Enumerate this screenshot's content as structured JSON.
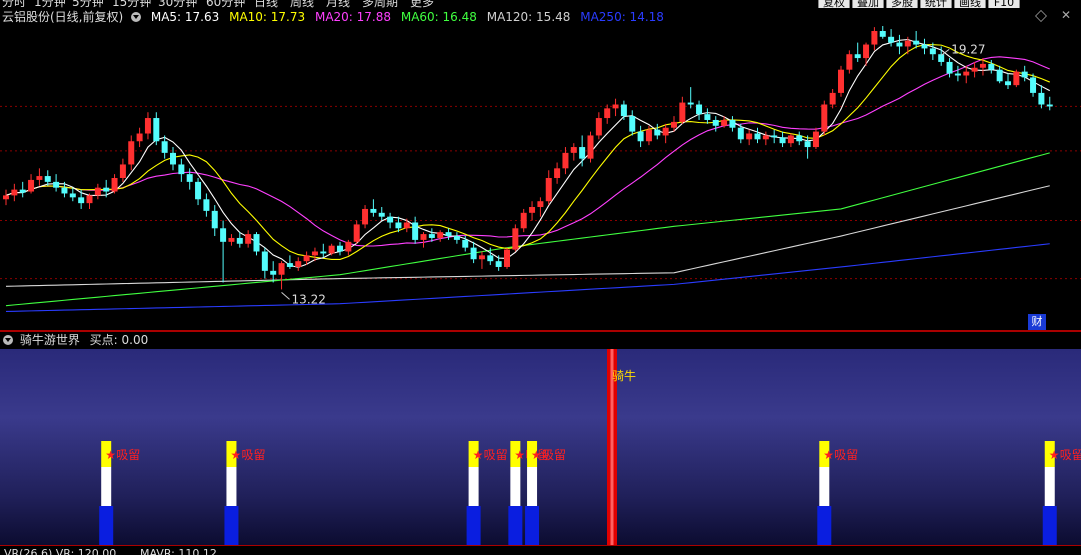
{
  "header": {
    "stock_name": "云铝股份(日线,前复权)",
    "ma_items": [
      {
        "label": "MA5: 17.63",
        "color": "#ffffff"
      },
      {
        "label": "MA10: 17.73",
        "color": "#ffff00"
      },
      {
        "label": "MA20: 17.88",
        "color": "#ff40ff"
      },
      {
        "label": "MA60: 16.48",
        "color": "#40ff40"
      },
      {
        "label": "MA120: 15.48",
        "color": "#d0d0d0"
      },
      {
        "label": "MA250: 14.18",
        "color": "#2a3cff"
      }
    ]
  },
  "top_tabs": [
    "分时",
    "1分钟",
    "5分钟",
    "15分钟",
    "30分钟",
    "60分钟",
    "日线",
    "周线",
    "月线",
    "多周期",
    "更多"
  ],
  "top_buttons": [
    "复权",
    "叠加",
    "多股",
    "统计",
    "画线",
    "F10"
  ],
  "indicator": {
    "name": "骑牛游世界",
    "value_label": "买点: 0.00"
  },
  "bottom_text": [
    "VR(26,6) VR: 120.00",
    "MAVR: 110.12"
  ],
  "badge": "财",
  "colors": {
    "up": "#ff3030",
    "down": "#54fcfc",
    "grid": "#8b0000"
  },
  "chart_data": [
    {
      "type": "candlestick",
      "ylim": [
        12.3,
        19.9
      ],
      "annotations": [
        {
          "label": "19.27",
          "index": 112,
          "value": 19.27
        },
        {
          "label": "13.22",
          "index": 33,
          "value": 13.22
        }
      ],
      "candles": [
        [
          15.55,
          15.8,
          15.4,
          15.65
        ],
        [
          15.65,
          15.95,
          15.5,
          15.8
        ],
        [
          15.8,
          16.0,
          15.6,
          15.72
        ],
        [
          15.75,
          16.2,
          15.7,
          16.05
        ],
        [
          16.05,
          16.35,
          15.9,
          16.15
        ],
        [
          16.15,
          16.3,
          15.9,
          16.0
        ],
        [
          16.0,
          16.2,
          15.75,
          15.85
        ],
        [
          15.85,
          16.0,
          15.6,
          15.7
        ],
        [
          15.7,
          15.85,
          15.5,
          15.6
        ],
        [
          15.6,
          15.8,
          15.3,
          15.45
        ],
        [
          15.45,
          15.7,
          15.3,
          15.65
        ],
        [
          15.65,
          15.95,
          15.55,
          15.85
        ],
        [
          15.85,
          16.05,
          15.6,
          15.75
        ],
        [
          15.75,
          16.2,
          15.7,
          16.1
        ],
        [
          16.1,
          16.6,
          16.0,
          16.45
        ],
        [
          16.45,
          17.2,
          16.3,
          17.05
        ],
        [
          17.05,
          17.4,
          16.9,
          17.25
        ],
        [
          17.25,
          17.8,
          17.1,
          17.65
        ],
        [
          17.65,
          17.8,
          16.95,
          17.05
        ],
        [
          17.05,
          17.2,
          16.6,
          16.75
        ],
        [
          16.75,
          16.9,
          16.3,
          16.45
        ],
        [
          16.45,
          16.6,
          16.0,
          16.2
        ],
        [
          16.2,
          16.35,
          15.8,
          16.0
        ],
        [
          16.0,
          16.1,
          15.4,
          15.55
        ],
        [
          15.55,
          15.7,
          15.1,
          15.25
        ],
        [
          15.25,
          15.4,
          14.6,
          14.8
        ],
        [
          14.8,
          15.0,
          13.4,
          14.45
        ],
        [
          14.45,
          14.65,
          14.35,
          14.55
        ],
        [
          14.55,
          14.7,
          14.3,
          14.4
        ],
        [
          14.4,
          14.75,
          14.3,
          14.65
        ],
        [
          14.65,
          14.7,
          14.1,
          14.2
        ],
        [
          14.2,
          14.3,
          13.5,
          13.7
        ],
        [
          13.7,
          13.95,
          13.4,
          13.6
        ],
        [
          13.6,
          13.95,
          13.22,
          13.9
        ],
        [
          13.9,
          14.1,
          13.75,
          13.8
        ],
        [
          13.8,
          14.05,
          13.7,
          13.95
        ],
        [
          13.95,
          14.2,
          13.85,
          14.1
        ],
        [
          14.1,
          14.3,
          13.95,
          14.2
        ],
        [
          14.2,
          14.4,
          14.05,
          14.15
        ],
        [
          14.15,
          14.4,
          14.1,
          14.35
        ],
        [
          14.35,
          14.45,
          14.1,
          14.2
        ],
        [
          14.2,
          14.5,
          14.1,
          14.45
        ],
        [
          14.45,
          15.0,
          14.4,
          14.9
        ],
        [
          14.9,
          15.4,
          14.8,
          15.3
        ],
        [
          15.3,
          15.55,
          15.1,
          15.2
        ],
        [
          15.2,
          15.35,
          15.0,
          15.1
        ],
        [
          15.1,
          15.2,
          14.8,
          14.95
        ],
        [
          14.95,
          15.1,
          14.7,
          14.8
        ],
        [
          14.8,
          15.05,
          14.7,
          14.95
        ],
        [
          14.95,
          15.1,
          14.4,
          14.5
        ],
        [
          14.5,
          14.7,
          14.3,
          14.65
        ],
        [
          14.65,
          14.8,
          14.45,
          14.55
        ],
        [
          14.55,
          14.75,
          14.45,
          14.7
        ],
        [
          14.7,
          14.8,
          14.5,
          14.6
        ],
        [
          14.6,
          14.7,
          14.4,
          14.5
        ],
        [
          14.5,
          14.6,
          14.2,
          14.3
        ],
        [
          14.3,
          14.45,
          13.9,
          14.0
        ],
        [
          14.0,
          14.2,
          13.75,
          14.1
        ],
        [
          14.1,
          14.3,
          13.85,
          13.95
        ],
        [
          13.95,
          14.1,
          13.7,
          13.8
        ],
        [
          13.8,
          14.3,
          13.75,
          14.25
        ],
        [
          14.25,
          14.9,
          14.2,
          14.8
        ],
        [
          14.8,
          15.3,
          14.7,
          15.2
        ],
        [
          15.2,
          15.5,
          15.0,
          15.35
        ],
        [
          15.35,
          15.6,
          15.1,
          15.5
        ],
        [
          15.5,
          16.3,
          15.4,
          16.1
        ],
        [
          16.1,
          16.5,
          15.95,
          16.35
        ],
        [
          16.35,
          16.9,
          16.2,
          16.75
        ],
        [
          16.75,
          17.0,
          16.55,
          16.9
        ],
        [
          16.9,
          17.2,
          16.4,
          16.6
        ],
        [
          16.6,
          17.3,
          16.5,
          17.2
        ],
        [
          17.2,
          17.8,
          17.1,
          17.65
        ],
        [
          17.65,
          18.0,
          17.5,
          17.9
        ],
        [
          17.9,
          18.15,
          17.7,
          18.0
        ],
        [
          18.0,
          18.1,
          17.6,
          17.7
        ],
        [
          17.7,
          17.85,
          17.2,
          17.3
        ],
        [
          17.3,
          17.45,
          16.9,
          17.05
        ],
        [
          17.05,
          17.45,
          16.95,
          17.35
        ],
        [
          17.35,
          17.5,
          17.1,
          17.2
        ],
        [
          17.2,
          17.5,
          17.0,
          17.4
        ],
        [
          17.4,
          17.7,
          17.3,
          17.55
        ],
        [
          17.55,
          18.2,
          17.5,
          18.05
        ],
        [
          18.05,
          18.45,
          17.9,
          18.0
        ],
        [
          18.0,
          18.1,
          17.6,
          17.75
        ],
        [
          17.75,
          17.9,
          17.5,
          17.6
        ],
        [
          17.6,
          17.7,
          17.3,
          17.45
        ],
        [
          17.45,
          17.7,
          17.4,
          17.6
        ],
        [
          17.6,
          17.7,
          17.3,
          17.4
        ],
        [
          17.4,
          17.5,
          17.0,
          17.1
        ],
        [
          17.1,
          17.35,
          16.95,
          17.25
        ],
        [
          17.25,
          17.4,
          17.0,
          17.1
        ],
        [
          17.1,
          17.3,
          16.95,
          17.2
        ],
        [
          17.2,
          17.35,
          17.0,
          17.15
        ],
        [
          17.15,
          17.3,
          16.9,
          17.0
        ],
        [
          17.0,
          17.25,
          16.9,
          17.2
        ],
        [
          17.2,
          17.3,
          16.95,
          17.05
        ],
        [
          17.05,
          17.2,
          16.6,
          16.9
        ],
        [
          16.9,
          17.4,
          16.85,
          17.3
        ],
        [
          17.3,
          18.1,
          17.2,
          18.0
        ],
        [
          18.0,
          18.4,
          17.9,
          18.3
        ],
        [
          18.3,
          19.0,
          18.2,
          18.9
        ],
        [
          18.9,
          19.4,
          18.8,
          19.3
        ],
        [
          19.3,
          19.6,
          19.1,
          19.2
        ],
        [
          19.2,
          19.6,
          19.0,
          19.55
        ],
        [
          19.55,
          20.0,
          19.4,
          19.9
        ],
        [
          19.9,
          20.1,
          19.7,
          19.75
        ],
        [
          19.75,
          19.95,
          19.5,
          19.6
        ],
        [
          19.6,
          19.8,
          19.3,
          19.5
        ],
        [
          19.5,
          19.75,
          19.3,
          19.65
        ],
        [
          19.65,
          19.9,
          19.45,
          19.55
        ],
        [
          19.55,
          19.7,
          19.3,
          19.45
        ],
        [
          19.45,
          19.6,
          19.15,
          19.3
        ],
        [
          19.3,
          19.5,
          19.0,
          19.1
        ],
        [
          19.1,
          19.2,
          18.7,
          18.8
        ],
        [
          18.8,
          19.0,
          18.6,
          18.75
        ],
        [
          18.75,
          19.0,
          18.55,
          18.85
        ],
        [
          18.85,
          19.1,
          18.7,
          18.95
        ],
        [
          18.95,
          19.2,
          18.75,
          19.05
        ],
        [
          19.05,
          19.15,
          18.8,
          18.9
        ],
        [
          18.9,
          19.0,
          18.55,
          18.6
        ],
        [
          18.6,
          18.8,
          18.4,
          18.5
        ],
        [
          18.5,
          18.9,
          18.45,
          18.85
        ],
        [
          18.85,
          19.0,
          18.6,
          18.7
        ],
        [
          18.7,
          18.8,
          18.2,
          18.3
        ],
        [
          18.3,
          18.5,
          17.9,
          18.0
        ],
        [
          18.0,
          18.2,
          17.85,
          17.95
        ]
      ],
      "ma_lines": [
        {
          "name": "MA5",
          "color": "#ffffff"
        },
        {
          "name": "MA10",
          "color": "#ffff00"
        },
        {
          "name": "MA20",
          "color": "#ff40ff"
        },
        {
          "name": "MA60",
          "color": "#40ff40"
        },
        {
          "name": "MA120",
          "color": "#d8d8d8"
        },
        {
          "name": "MA250",
          "color": "#2a3cff"
        }
      ],
      "ma60": [
        [
          0,
          12.8
        ],
        [
          40,
          13.6
        ],
        [
          60,
          14.3
        ],
        [
          80,
          14.85
        ],
        [
          100,
          15.3
        ],
        [
          125,
          16.75
        ]
      ],
      "ma120": [
        [
          0,
          13.3
        ],
        [
          40,
          13.5
        ],
        [
          80,
          13.65
        ],
        [
          100,
          14.6
        ],
        [
          125,
          15.9
        ]
      ],
      "ma250": [
        [
          0,
          12.65
        ],
        [
          40,
          12.85
        ],
        [
          80,
          13.35
        ],
        [
          100,
          13.8
        ],
        [
          125,
          14.4
        ]
      ]
    },
    {
      "type": "signal-bars",
      "name": "骑牛游世界",
      "signal_label": "吸留",
      "bull_label": "骑牛",
      "signals": [
        12,
        27,
        56,
        61,
        63,
        98,
        125
      ],
      "bull_index": 75
    }
  ]
}
